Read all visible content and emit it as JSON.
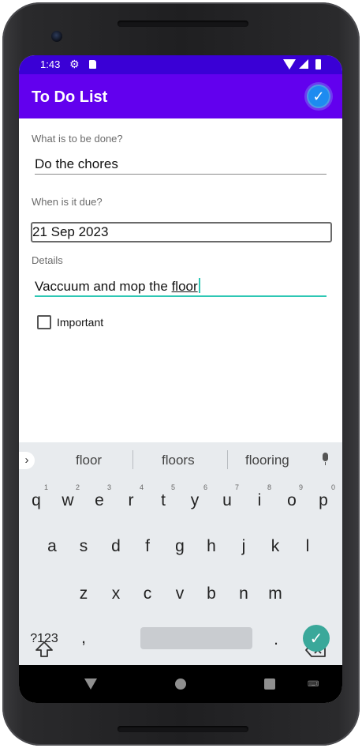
{
  "status_bar": {
    "time": "1:43",
    "icons": [
      "settings-icon",
      "sd-card-icon",
      "wifi-icon",
      "signal-icon",
      "battery-icon"
    ]
  },
  "app_bar": {
    "title": "To Do List",
    "action_icon": "check-circle-icon"
  },
  "form": {
    "task_label": "What is to be done?",
    "task_value": "Do the chores",
    "due_label": "When is it due?",
    "due_value": "21 Sep 2023",
    "details_label": "Details",
    "details_value_prefix": "Vaccuum and mop the ",
    "details_value_word": "floor",
    "important_label": "Important",
    "important_checked": false
  },
  "keyboard": {
    "suggestions": [
      "floor",
      "floors",
      "flooring"
    ],
    "row1": [
      "q",
      "w",
      "e",
      "r",
      "t",
      "y",
      "u",
      "i",
      "o",
      "p"
    ],
    "row1_hints": [
      "1",
      "2",
      "3",
      "4",
      "5",
      "6",
      "7",
      "8",
      "9",
      "0"
    ],
    "row2": [
      "a",
      "s",
      "d",
      "f",
      "g",
      "h",
      "j",
      "k",
      "l"
    ],
    "row3": [
      "z",
      "x",
      "c",
      "v",
      "b",
      "n",
      "m"
    ],
    "symbols_key": "?123",
    "comma_key": ",",
    "period_key": "."
  },
  "colors": {
    "status_bar": "#3a00d6",
    "app_bar": "#6200ee",
    "accent": "#2ec7b4",
    "enter_key": "#3aa89a"
  }
}
